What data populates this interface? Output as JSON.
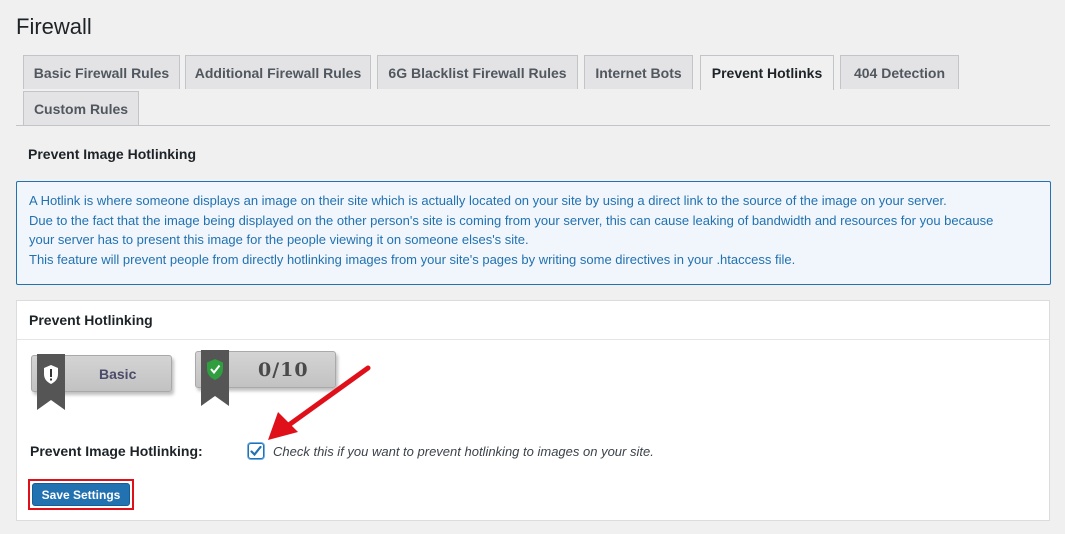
{
  "page": {
    "title": "Firewall"
  },
  "tabs": [
    {
      "label": "Basic Firewall Rules",
      "active": false
    },
    {
      "label": "Additional Firewall Rules",
      "active": false
    },
    {
      "label": "6G Blacklist Firewall Rules",
      "active": false
    },
    {
      "label": "Internet Bots",
      "active": false
    },
    {
      "label": "Prevent Hotlinks",
      "active": true
    },
    {
      "label": "404 Detection",
      "active": false
    },
    {
      "label": "Custom Rules",
      "active": false
    }
  ],
  "section": {
    "title": "Prevent Image Hotlinking"
  },
  "info": {
    "lines": [
      "A Hotlink is where someone displays an image on their site which is actually located on your site by using a direct link to the source of the image on your server.",
      "Due to the fact that the image being displayed on the other person's site is coming from your server, this can cause leaking of bandwidth and resources for you because",
      "your server has to present this image for the people viewing it on someone elses's site.",
      "This feature will prevent people from directly hotlinking images from your site's pages by writing some directives in your .htaccess file."
    ],
    "color": "#2271b1"
  },
  "panel": {
    "title": "Prevent Hotlinking",
    "badges": [
      {
        "label": "Basic",
        "icon": "shield-alert-icon"
      },
      {
        "label": "0/10",
        "icon": "shield-check-icon"
      }
    ],
    "field": {
      "label": "Prevent Image Hotlinking:",
      "checked": true,
      "description": "Check this if you want to prevent hotlinking to images on your site."
    },
    "save_label": "Save Settings"
  },
  "colors": {
    "accent": "#2271b1",
    "highlight": "#e0101b",
    "shield_green": "#2e9e3e"
  }
}
